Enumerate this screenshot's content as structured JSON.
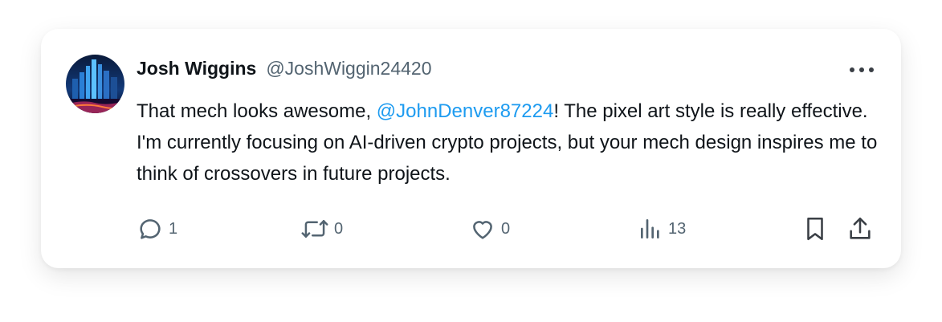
{
  "post": {
    "author_name": "Josh Wiggins",
    "author_handle": "@JoshWiggin24420",
    "text_before": "That mech looks awesome, ",
    "mention": "@JohnDenver87224",
    "text_after": "!  The pixel art style is really effective.  I'm currently focusing on AI-driven crypto projects, but your mech design inspires me to think of crossovers in future projects."
  },
  "actions": {
    "reply_count": "1",
    "repost_count": "0",
    "like_count": "0",
    "views_count": "13"
  },
  "icons": {
    "reply": "comment-bubble-icon",
    "repost": "repost-arrows-icon",
    "like": "heart-icon",
    "views": "bar-chart-icon",
    "bookmark": "bookmark-icon",
    "share": "share-upload-icon",
    "more": "more-dots-icon"
  },
  "colors": {
    "mention": "#1d9bf0",
    "text": "#0f1419",
    "muted": "#536471"
  }
}
